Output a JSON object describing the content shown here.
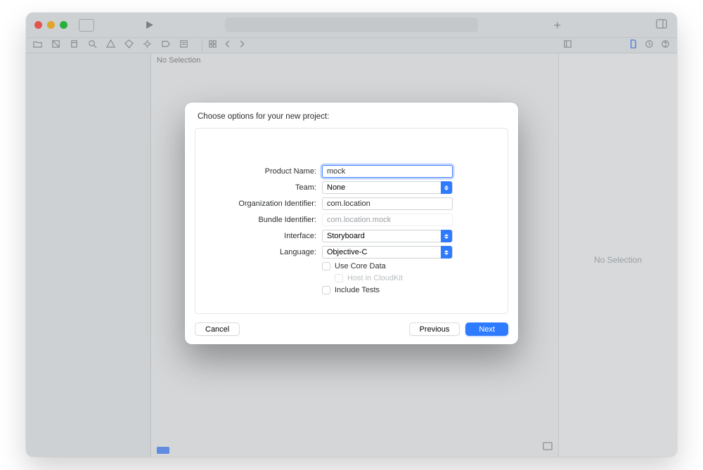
{
  "window": {
    "center_no_selection": "No Selection",
    "inspector_no_selection": "No Selection"
  },
  "sheet": {
    "title": "Choose options for your new project:",
    "labels": {
      "product_name": "Product Name:",
      "team": "Team:",
      "org_id": "Organization Identifier:",
      "bundle_id": "Bundle Identifier:",
      "interface": "Interface:",
      "language": "Language:"
    },
    "values": {
      "product_name": "mock",
      "team": "None",
      "org_id": "com.location",
      "bundle_id": "com.location.mock",
      "interface": "Storyboard",
      "language": "Objective-C"
    },
    "checkboxes": {
      "core_data": "Use Core Data",
      "cloudkit": "Host in CloudKit",
      "tests": "Include Tests"
    },
    "buttons": {
      "cancel": "Cancel",
      "previous": "Previous",
      "next": "Next"
    }
  }
}
